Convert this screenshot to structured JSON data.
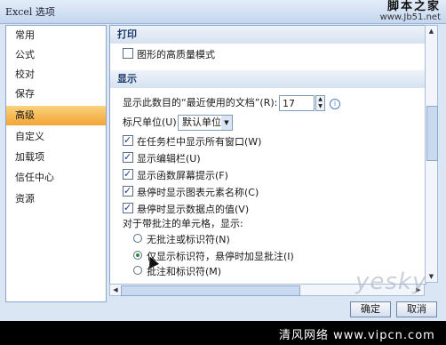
{
  "window": {
    "title": "Excel 选项"
  },
  "watermark_top": {
    "site": "脚本之家",
    "url": "www.Jb51.net"
  },
  "sidebar": {
    "items": [
      {
        "label": "常用"
      },
      {
        "label": "公式"
      },
      {
        "label": "校对"
      },
      {
        "label": "保存"
      },
      {
        "label": "高级",
        "active": true
      },
      {
        "label": "自定义"
      },
      {
        "label": "加载项"
      },
      {
        "label": "信任中心"
      },
      {
        "label": "资源"
      }
    ]
  },
  "print_section": {
    "header": "打印",
    "high_quality": {
      "label": "图形的高质量模式",
      "checked": false
    }
  },
  "display_section": {
    "header": "显示",
    "recent_docs": {
      "label": "显示此数目的“最近使用的文档”(R):",
      "value": "17"
    },
    "ruler_units": {
      "label": "标尺单位(U)",
      "value": "默认单位"
    },
    "checkboxes": [
      {
        "label": "在任务栏中显示所有窗口(W)",
        "checked": true
      },
      {
        "label": "显示编辑栏(U)",
        "checked": true
      },
      {
        "label": "显示函数屏幕提示(F)",
        "checked": true
      },
      {
        "label": "悬停时显示图表元素名称(C)",
        "checked": true
      },
      {
        "label": "悬停时显示数据点的值(V)",
        "checked": true
      }
    ],
    "comment_label": "对于带批注的单元格，显示:",
    "radios": [
      {
        "label": "无批注或标识符(N)",
        "checked": false
      },
      {
        "label": "仅显示标识符，悬停时加显批注(I)",
        "checked": true
      },
      {
        "label": "批注和标识符(M)",
        "checked": false
      }
    ]
  },
  "buttons": {
    "ok": "确定",
    "cancel": "取消"
  },
  "watermark_bottom": {
    "yesky": "yesky",
    "text": "清风网络 www.vipcn.com"
  }
}
